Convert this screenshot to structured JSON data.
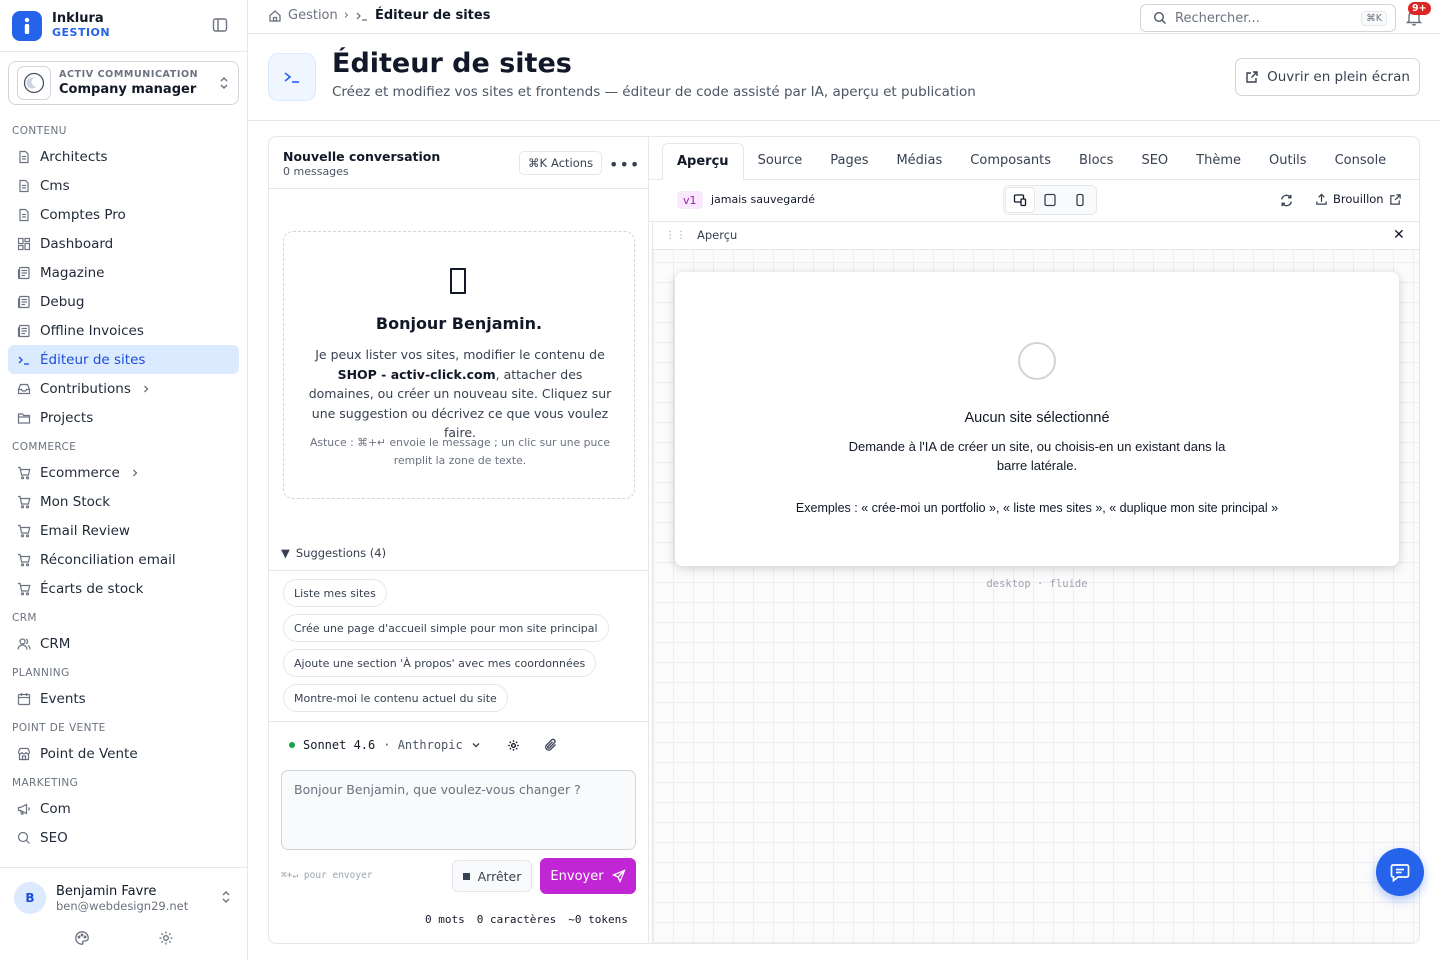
{
  "brand": {
    "name": "Inklura",
    "subtitle": "GESTION"
  },
  "org": {
    "kicker": "ACTIV COMMUNICATION",
    "name": "Company manager"
  },
  "nav": {
    "sections": [
      {
        "title": "CONTENU",
        "items": [
          {
            "label": "Architects",
            "icon": "document-icon"
          },
          {
            "label": "Cms",
            "icon": "document-icon"
          },
          {
            "label": "Comptes Pro",
            "icon": "document-icon"
          },
          {
            "label": "Dashboard",
            "icon": "dashboard-icon"
          },
          {
            "label": "Magazine",
            "icon": "newspaper-icon"
          },
          {
            "label": "Debug",
            "icon": "newspaper-icon"
          },
          {
            "label": "Offline Invoices",
            "icon": "newspaper-icon"
          },
          {
            "label": "Éditeur de sites",
            "icon": "terminal-icon",
            "active": true
          },
          {
            "label": "Contributions",
            "icon": "inbox-icon",
            "chevron": true
          },
          {
            "label": "Projects",
            "icon": "folder-icon"
          }
        ]
      },
      {
        "title": "COMMERCE",
        "items": [
          {
            "label": "Ecommerce",
            "icon": "cart-icon",
            "chevron": true
          },
          {
            "label": "Mon Stock",
            "icon": "cart-icon"
          },
          {
            "label": "Email Review",
            "icon": "cart-icon"
          },
          {
            "label": "Réconciliation email",
            "icon": "cart-icon"
          },
          {
            "label": "Écarts de stock",
            "icon": "cart-icon"
          }
        ]
      },
      {
        "title": "CRM",
        "items": [
          {
            "label": "CRM",
            "icon": "users-icon"
          }
        ]
      },
      {
        "title": "PLANNING",
        "items": [
          {
            "label": "Events",
            "icon": "calendar-icon"
          }
        ]
      },
      {
        "title": "POINT DE VENTE",
        "items": [
          {
            "label": "Point de Vente",
            "icon": "store-icon"
          }
        ]
      },
      {
        "title": "MARKETING",
        "items": [
          {
            "label": "Com",
            "icon": "megaphone-icon"
          },
          {
            "label": "SEO",
            "icon": "search-icon"
          }
        ]
      }
    ]
  },
  "user": {
    "initial": "B",
    "name": "Benjamin Favre",
    "email": "ben@webdesign29.net"
  },
  "topbar": {
    "breadcrumb_root": "Gestion",
    "breadcrumb_current": "Éditeur de sites",
    "search_placeholder": "Rechercher...",
    "search_shortcut": "⌘K",
    "notif_badge": "9+"
  },
  "page": {
    "title": "Éditeur de sites",
    "subtitle": "Créez et modifiez vos sites et frontends — éditeur de code assisté par IA, aperçu et publication",
    "fullscreen_label": "Ouvrir en plein écran"
  },
  "chat": {
    "title": "Nouvelle conversation",
    "count": "0 messages",
    "actions_shortcut": "⌘K",
    "actions_label": "Actions",
    "welcome_title": "Bonjour Benjamin.",
    "welcome_pre": "Je peux lister vos sites, modifier le contenu de ",
    "welcome_bold": "SHOP - activ-click.com",
    "welcome_post": ", attacher des domaines, ou créer un nouveau site. Cliquez sur une suggestion ou décrivez ce que vous voulez faire.",
    "tip": "Astuce : ⌘+↵ envoie le message ; un clic sur une puce remplit la zone de texte.",
    "suggestions_label": "Suggestions (4)",
    "suggestions": [
      "Liste mes sites",
      "Crée une page d'accueil simple pour mon site principal",
      "Ajoute une section 'À propos' avec mes coordonnées",
      "Montre-moi le contenu actuel du site"
    ],
    "model_name": "Sonnet 4.6",
    "model_vendor": "· Anthropic",
    "input_placeholder": "Bonjour Benjamin, que voulez-vous changer ?",
    "send_hint": "⌘+↵ pour envoyer",
    "stop_label": "Arrêter",
    "send_label": "Envoyer",
    "words": "0 mots",
    "chars": "0 caractères",
    "tokens": "~0 tokens"
  },
  "preview": {
    "tabs": [
      "Aperçu",
      "Source",
      "Pages",
      "Médias",
      "Composants",
      "Blocs",
      "SEO",
      "Thème",
      "Outils",
      "Console"
    ],
    "active_tab": "Aperçu",
    "version": "v1",
    "version_status": "jamais sauvegardé",
    "draft_label": "Brouillon",
    "frame_title": "Aperçu",
    "empty_title": "Aucun site sélectionné",
    "empty_body": "Demande à l'IA de créer un site, ou choisis-en un existant dans la barre latérale.",
    "empty_examples": "Exemples : « crée-moi un portfolio », « liste mes sites », « duplique mon site principal »",
    "viewport_label": "desktop · fluide"
  },
  "colors": {
    "accent": "#2563eb",
    "send": "#c026d3",
    "active_nav": "#dbeafe",
    "badge": "#dc2626"
  }
}
